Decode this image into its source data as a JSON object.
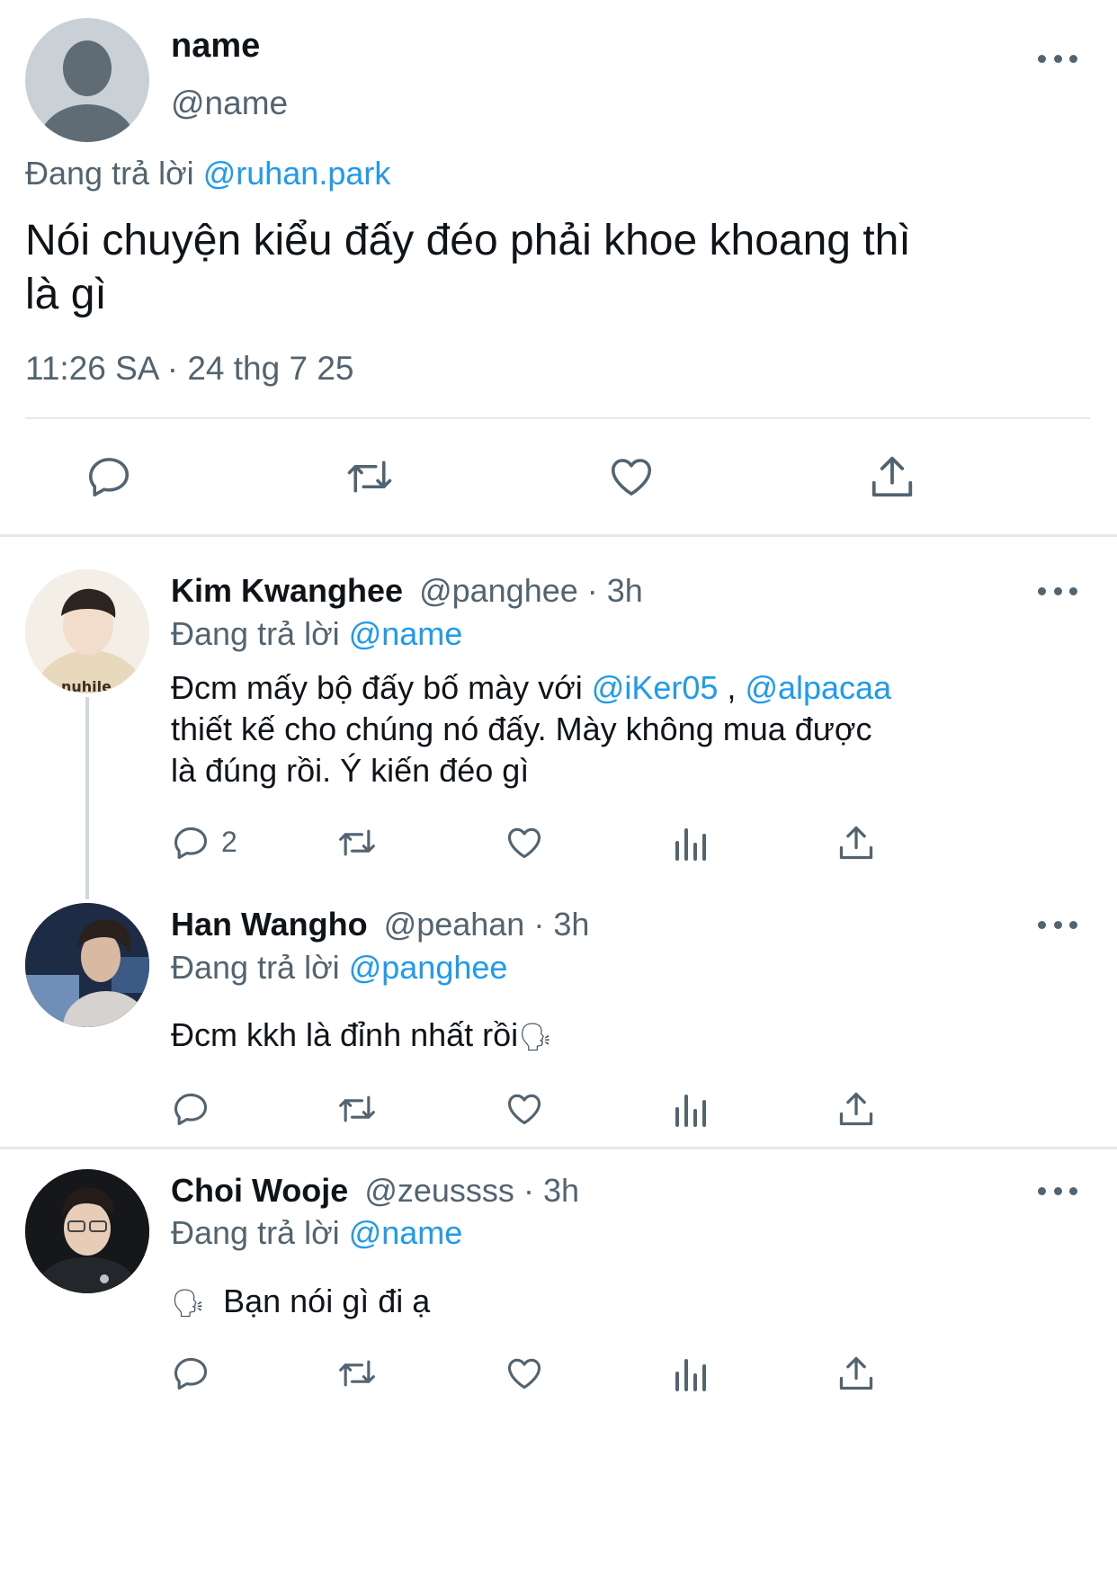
{
  "main_tweet": {
    "display_name": "name",
    "handle": "@name",
    "reply_prefix": "Đang trả lời",
    "reply_to": "@ruhan.park",
    "text_line1": "Nói chuyện kiểu đấy đéo phải khoe khoang thì",
    "text_line2": "là gì",
    "timestamp": "11:26 SA · 24 thg 7 25",
    "actions": [
      "reply-icon",
      "retweet-icon",
      "like-icon",
      "share-icon"
    ]
  },
  "replies": [
    {
      "display_name": "Kim Kwanghee",
      "handle": "@panghee",
      "time": "· 3h",
      "reply_prefix": "Đang trả lời",
      "reply_to": "@name",
      "line1_text": "Đcm mấy bộ đấy bố mày với",
      "mention1": "@iKer05",
      "sep": ",",
      "mention2": "@alpacaa",
      "line2": "thiết kế cho chúng nó đấy. Mày không mua được",
      "line3": "là đúng rồi. Ý kiến đéo gì",
      "reply_count": "2"
    },
    {
      "display_name": "Han Wangho",
      "handle": "@peahan",
      "time": "· 3h",
      "reply_prefix": "Đang trả lời",
      "reply_to": "@panghee",
      "text": "Đcm kkh là đỉnh nhất rồi",
      "emoji": "🗣"
    },
    {
      "display_name": "Choi Wooje",
      "handle": "@zeussss",
      "time": "· 3h",
      "reply_prefix": "Đang trả lời",
      "reply_to": "@name",
      "emoji": "🗣",
      "text": "Bạn nói gì đi ạ"
    }
  ],
  "colors": {
    "link": "#1d9bf0",
    "secondary": "#536471",
    "text": "#0f1419",
    "divider": "#e6e9eb"
  }
}
